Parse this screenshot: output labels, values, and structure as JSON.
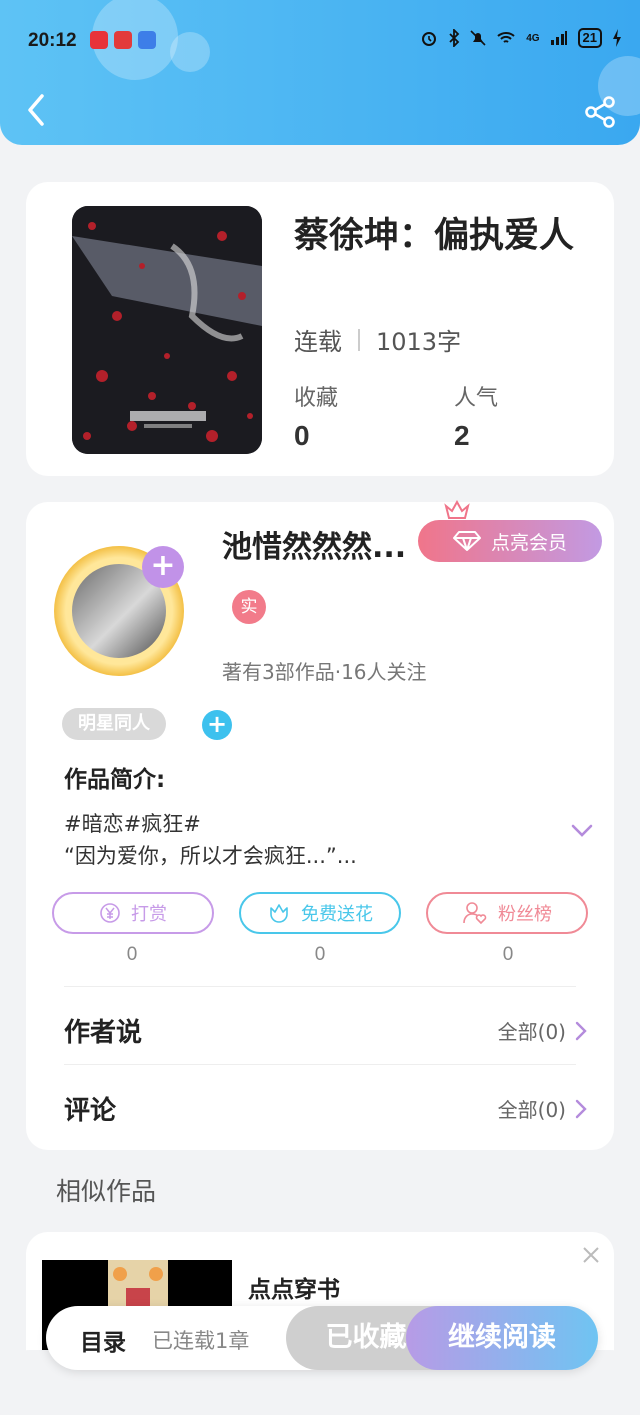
{
  "status_bar": {
    "time": "20:12",
    "network": "4G",
    "battery": "21"
  },
  "book": {
    "title": "蔡徐坤：偏执爱人",
    "status": "连载",
    "word_count": "1013字",
    "stats": [
      {
        "label": "收藏",
        "value": "0"
      },
      {
        "label": "人气",
        "value": "2"
      }
    ]
  },
  "author": {
    "name": "池惜然然然...",
    "vip_button": "点亮会员",
    "real_badge": "实",
    "meta": "著有3部作品·16人关注",
    "tag": "明星同人",
    "intro_title": "作品简介:",
    "intro_tags": "#暗恋#疯狂#",
    "intro_text": "“因为爱你，所以才会疯狂...”..."
  },
  "actions": [
    {
      "label": "打赏",
      "count": "0",
      "color": "#c79be8"
    },
    {
      "label": "免费送花",
      "count": "0",
      "color": "#49c7ea"
    },
    {
      "label": "粉丝榜",
      "count": "0",
      "color": "#f08a96"
    }
  ],
  "rows": {
    "author_says": {
      "title": "作者说",
      "link": "全部(0)"
    },
    "comments": {
      "title": "评论",
      "link": "全部(0)"
    }
  },
  "similar": {
    "section_title": "相似作品",
    "items": [
      {
        "title": "点点穿书"
      }
    ]
  },
  "bottom_bar": {
    "toc": "目录",
    "chapters": "已连载1章",
    "favorited": "已收藏",
    "continue": "继续阅读"
  },
  "colors": {
    "header": "#3aa8f0",
    "accent_purple": "#c192e8",
    "accent_pink": "#f0758a"
  }
}
